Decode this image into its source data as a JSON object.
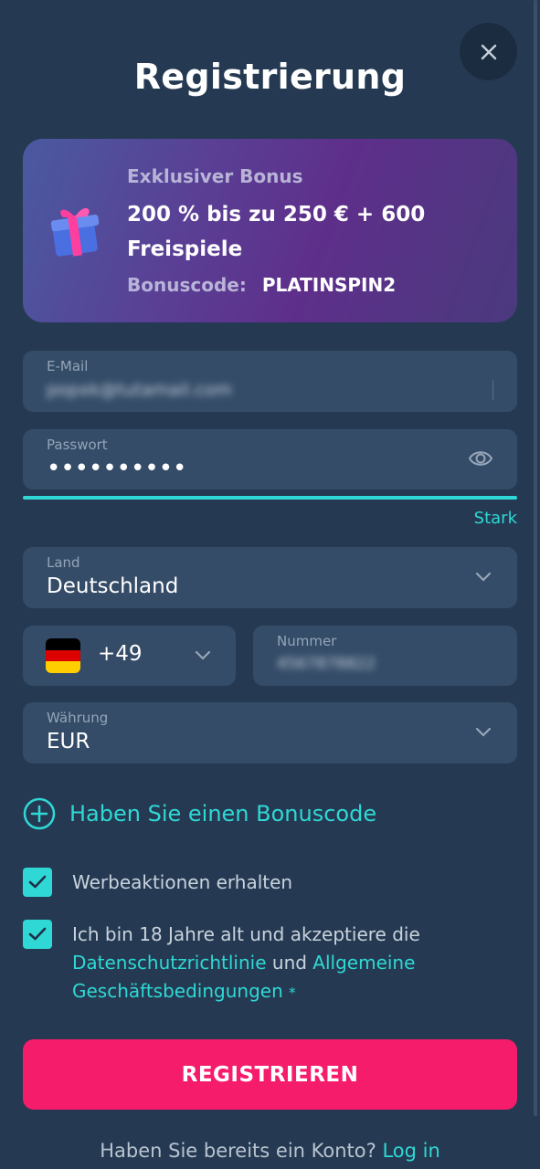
{
  "header": {
    "title": "Registrierung",
    "close_icon": "close-icon"
  },
  "bonus": {
    "subtitle": "Exklusiver Bonus",
    "main": "200 % bis zu 250 € + 600 Freispiele",
    "code_label": "Bonuscode:",
    "code_value": "PLATINSPIN2",
    "icon": "gift-icon"
  },
  "form": {
    "email": {
      "label": "E-Mail",
      "value": "popxk@tutamail.com"
    },
    "password": {
      "label": "Passwort",
      "value": "••••••••••",
      "strength": "Stark",
      "strength_fraction": 1.0
    },
    "country": {
      "label": "Land",
      "value": "Deutschland"
    },
    "phone": {
      "code": "+49",
      "number_label": "Nummer",
      "number_value": "4567878822"
    },
    "currency": {
      "label": "Währung",
      "value": "EUR"
    }
  },
  "bonus_code_link": "Haben Sie einen Bonuscode",
  "checkboxes": {
    "promo": {
      "label": "Werbeaktionen erhalten",
      "checked": true
    },
    "terms": {
      "text_before": "Ich bin 18 Jahre alt und akzeptiere die",
      "link1": "Datenschutzrichtlinie",
      "and": "und",
      "link2_a": "Allgemeine",
      "link2_b": "Geschäftsbedingungen",
      "required": "*",
      "checked": true
    }
  },
  "register_button": "REGISTRIEREN",
  "footer": {
    "question": "Haben Sie bereits ein Konto?",
    "login": "Log in"
  },
  "colors": {
    "background": "#253a52",
    "accent": "#2fd8d5",
    "primary_button": "#f51c6c",
    "field": "#344c68"
  }
}
